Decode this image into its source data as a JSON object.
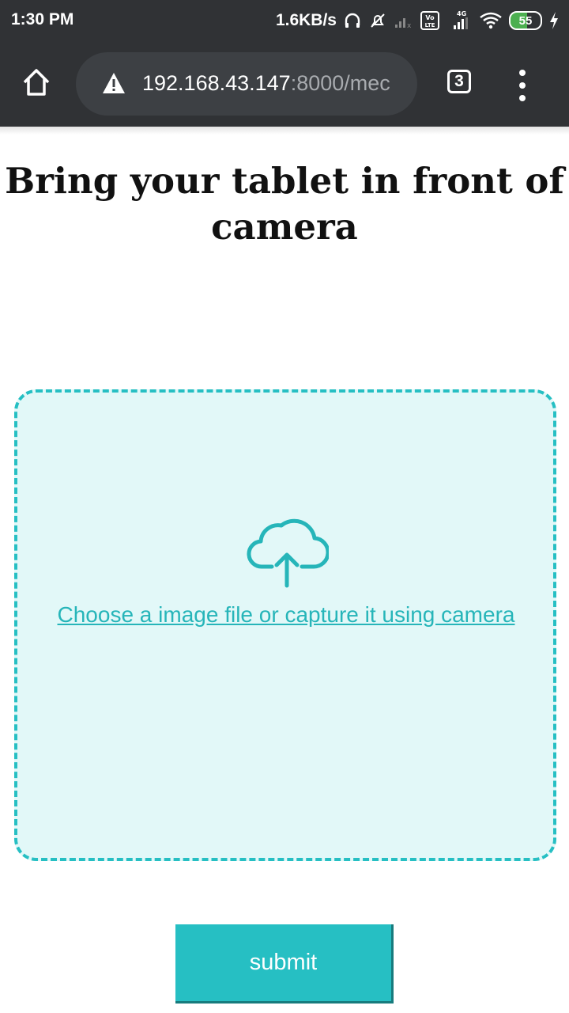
{
  "status_bar": {
    "time": "1:30 PM",
    "network_speed": "1.6KB/s",
    "icons": [
      "headphones-icon",
      "mute-icon",
      "signal-sim1-icon",
      "volte-icon",
      "signal-4g-icon",
      "wifi-icon",
      "charging-icon"
    ],
    "volte_label": "Vo LTE",
    "network_type": "4G",
    "battery_level": "55"
  },
  "browser": {
    "url_host": "192.168.43.147",
    "url_rest": ":8000/mec",
    "tab_count": "3",
    "icons": [
      "home-icon",
      "warning-icon",
      "tabs-icon",
      "overflow-menu-icon"
    ]
  },
  "page": {
    "title": "Bring your tablet in front of camera",
    "upload_prompt": "Choose a image file or capture it using camera",
    "upload_icon": "cloud-upload-icon",
    "submit_label": "submit"
  },
  "colors": {
    "toolbar": "#303235",
    "accent": "#26bfc3",
    "dropzone_bg": "#e2f8f8",
    "link": "#26b5b9"
  }
}
